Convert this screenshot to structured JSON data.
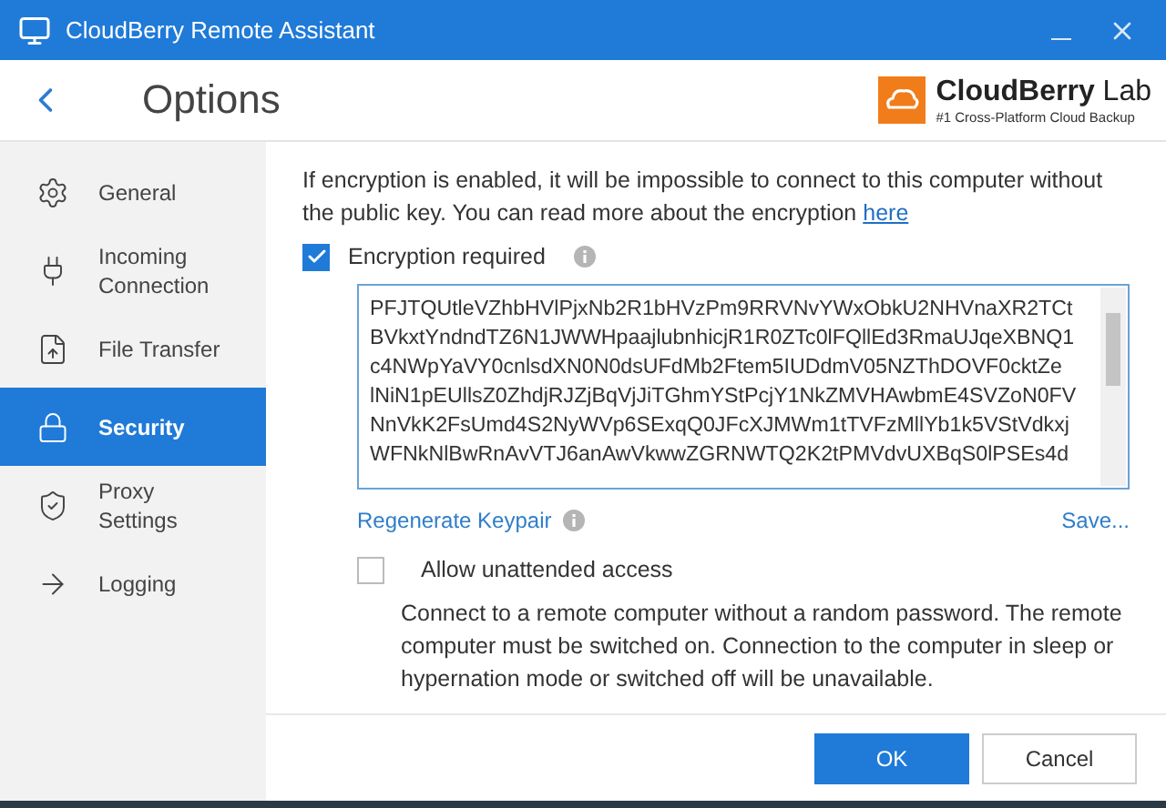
{
  "window": {
    "title": "CloudBerry Remote Assistant"
  },
  "header": {
    "title": "Options",
    "logo": {
      "brand": "CloudBerry",
      "suffix": "Lab",
      "tagline": "#1 Cross-Platform Cloud Backup"
    }
  },
  "sidebar": {
    "items": [
      {
        "label": "General",
        "kind": "gear",
        "selected": false
      },
      {
        "label": "Incoming Connection",
        "kind": "plug",
        "selected": false
      },
      {
        "label": "File Transfer",
        "kind": "upload",
        "selected": false
      },
      {
        "label": "Security",
        "kind": "lock",
        "selected": true
      },
      {
        "label": "Proxy Settings",
        "kind": "shield",
        "selected": false
      },
      {
        "label": "Logging",
        "kind": "arrow",
        "selected": false
      }
    ]
  },
  "security": {
    "intro": "If encryption is enabled, it will be impossible to connect to this computer without the public key. You can read more about the encryption ",
    "intro_link": "here",
    "encryption": {
      "label": "Encryption required",
      "checked": true
    },
    "key_lines": [
      "PFJTQUtleVZhbHVlPjxNb2R1bHVzPm9RRVNvYWxObkU2NHVnaXR2TCt",
      "BVkxtYndndTZ6N1JWWHpaajlubnhicjR1R0ZTc0lFQllEd3RmaUJqeXBNQ1",
      "c4NWpYaVY0cnlsdXN0N0dsUFdMb2Ftem5IUDdmV05NZThDOVF0cktZe",
      "lNiN1pEUllsZ0ZhdjRJZjBqVjJiTGhmYStPcjY1NkZMVHAwbmE4SVZoN0FV",
      "NnVkK2FsUmd4S2NyWVp6SExqQ0JFcXJMWm1tTVFzMllYb1k5VStVdkxj",
      "WFNkNlBwRnAvVTJ6anAwVkwwZGRNWTQ2K2tPMVdvUXBqS0lPSEs4d"
    ],
    "regenerate": "Regenerate Keypair",
    "save": "Save...",
    "unattended": {
      "label": "Allow unattended access",
      "checked": false,
      "description": "Connect to a remote computer without a random password. The remote computer must be switched on. Connection to the computer in sleep or hypernation mode or switched off will be unavailable."
    }
  },
  "buttons": [
    {
      "label": "OK",
      "kind": "primary"
    },
    {
      "label": "Cancel",
      "kind": "secondary"
    }
  ]
}
